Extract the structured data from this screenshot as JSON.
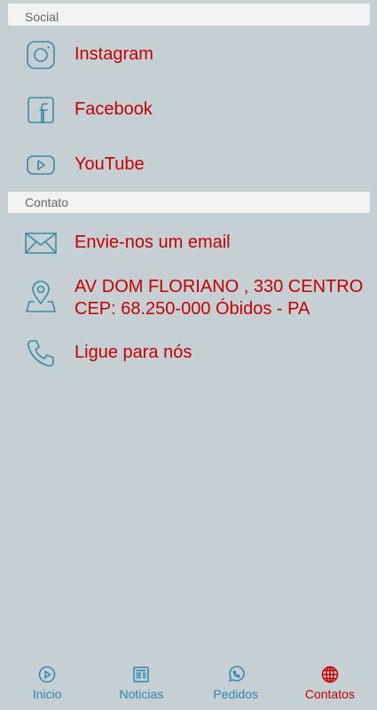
{
  "sections": {
    "social": "Social",
    "contato": "Contato"
  },
  "social": [
    {
      "label": "Instagram",
      "icon": "instagram-icon"
    },
    {
      "label": "Facebook",
      "icon": "facebook-icon"
    },
    {
      "label": "YouTube",
      "icon": "youtube-icon"
    }
  ],
  "contato": {
    "email": {
      "label": "Envie-nos um email",
      "icon": "email-icon"
    },
    "address": {
      "line1": "AV DOM FLORIANO , 330 CENTRO",
      "line2": "CEP: 68.250-000 Óbidos - PA",
      "icon": "map-pin-icon"
    },
    "phone": {
      "label": "Ligue para nós",
      "icon": "phone-icon"
    }
  },
  "nav": [
    {
      "label": "Inicio",
      "icon": "play-circle-icon",
      "active": false
    },
    {
      "label": "Noticias",
      "icon": "newspaper-icon",
      "active": false
    },
    {
      "label": "Pedidos",
      "icon": "whatsapp-icon",
      "active": false
    },
    {
      "label": "Contatos",
      "icon": "globe-icon",
      "active": true
    }
  ],
  "colors": {
    "background": "#c6d0d4",
    "accent_text": "#c40000",
    "icon": "#3a8aa8",
    "nav_inactive": "#2f86b5"
  }
}
